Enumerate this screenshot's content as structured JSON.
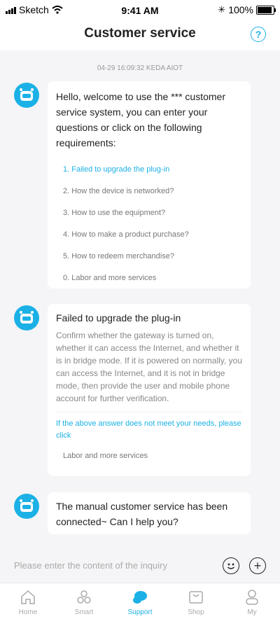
{
  "status": {
    "carrier": "Sketch",
    "time": "9:41 AM",
    "battery": "100%"
  },
  "nav": {
    "title": "Customer service",
    "help_icon": "?"
  },
  "timestamp": "04-29 16:09:32  KEDA AIOT",
  "bubble1": {
    "text": "Hello, welcome to use the *** customer service system, you can enter your questions or click on the following requirements:",
    "options": [
      "1. Failed to upgrade the plug-in",
      "2. How the device is networked?",
      "3. How to use the equipment?",
      "4. How to make a product purchase?",
      "5. How to redeem merchandise?",
      "0. Labor and more services"
    ]
  },
  "bubble2": {
    "title": "Failed to upgrade the plug-in",
    "body": "Confirm whether the gateway is turned on, whether it can access the Internet, and whether it is in bridge mode. If it is powered on normally, you can access the Internet, and it is not in bridge mode, then provide the user and mobile phone account for further verification.",
    "link": "If the above answer does not meet your needs,  please click",
    "labor": "Labor and more services"
  },
  "bubble3": {
    "text": "The manual customer service has been connected~ Can I help you?"
  },
  "input": {
    "placeholder": "Please enter the content of the inquiry"
  },
  "tabs": [
    {
      "label": "Home",
      "icon": "home-icon"
    },
    {
      "label": "Smart",
      "icon": "smart-icon"
    },
    {
      "label": "Support",
      "icon": "support-icon"
    },
    {
      "label": "Shop",
      "icon": "shop-icon"
    },
    {
      "label": "My",
      "icon": "user-icon"
    }
  ],
  "colors": {
    "accent": "#1bb1e6"
  }
}
